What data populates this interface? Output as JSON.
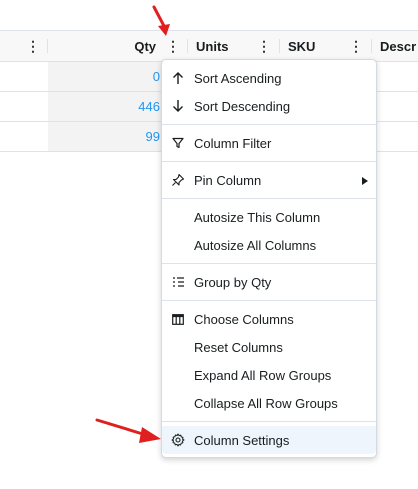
{
  "grid": {
    "headers": [
      {
        "label": "Qty"
      },
      {
        "label": "Units"
      },
      {
        "label": "SKU"
      },
      {
        "label": "Descr"
      }
    ],
    "rows": [
      {
        "qty": "0"
      },
      {
        "qty": "446"
      },
      {
        "qty": "99"
      }
    ]
  },
  "menu": {
    "items": [
      {
        "label": "Sort Ascending",
        "icon": "arrow-up-icon"
      },
      {
        "label": "Sort Descending",
        "icon": "arrow-down-icon"
      },
      {
        "label": "Column Filter",
        "icon": "filter-icon"
      },
      {
        "label": "Pin Column",
        "icon": "pin-icon"
      },
      {
        "label": "Autosize This Column",
        "icon": ""
      },
      {
        "label": "Autosize All Columns",
        "icon": ""
      },
      {
        "label": "Group by Qty",
        "icon": "group-icon"
      },
      {
        "label": "Choose Columns",
        "icon": "columns-icon"
      },
      {
        "label": "Reset Columns",
        "icon": ""
      },
      {
        "label": "Expand All Row Groups",
        "icon": ""
      },
      {
        "label": "Collapse All Row Groups",
        "icon": ""
      },
      {
        "label": "Column Settings",
        "icon": "gear-icon"
      }
    ]
  },
  "colors": {
    "accent": "#2196f3",
    "arrow": "#e02020",
    "active_bg": "#eef5fc"
  }
}
